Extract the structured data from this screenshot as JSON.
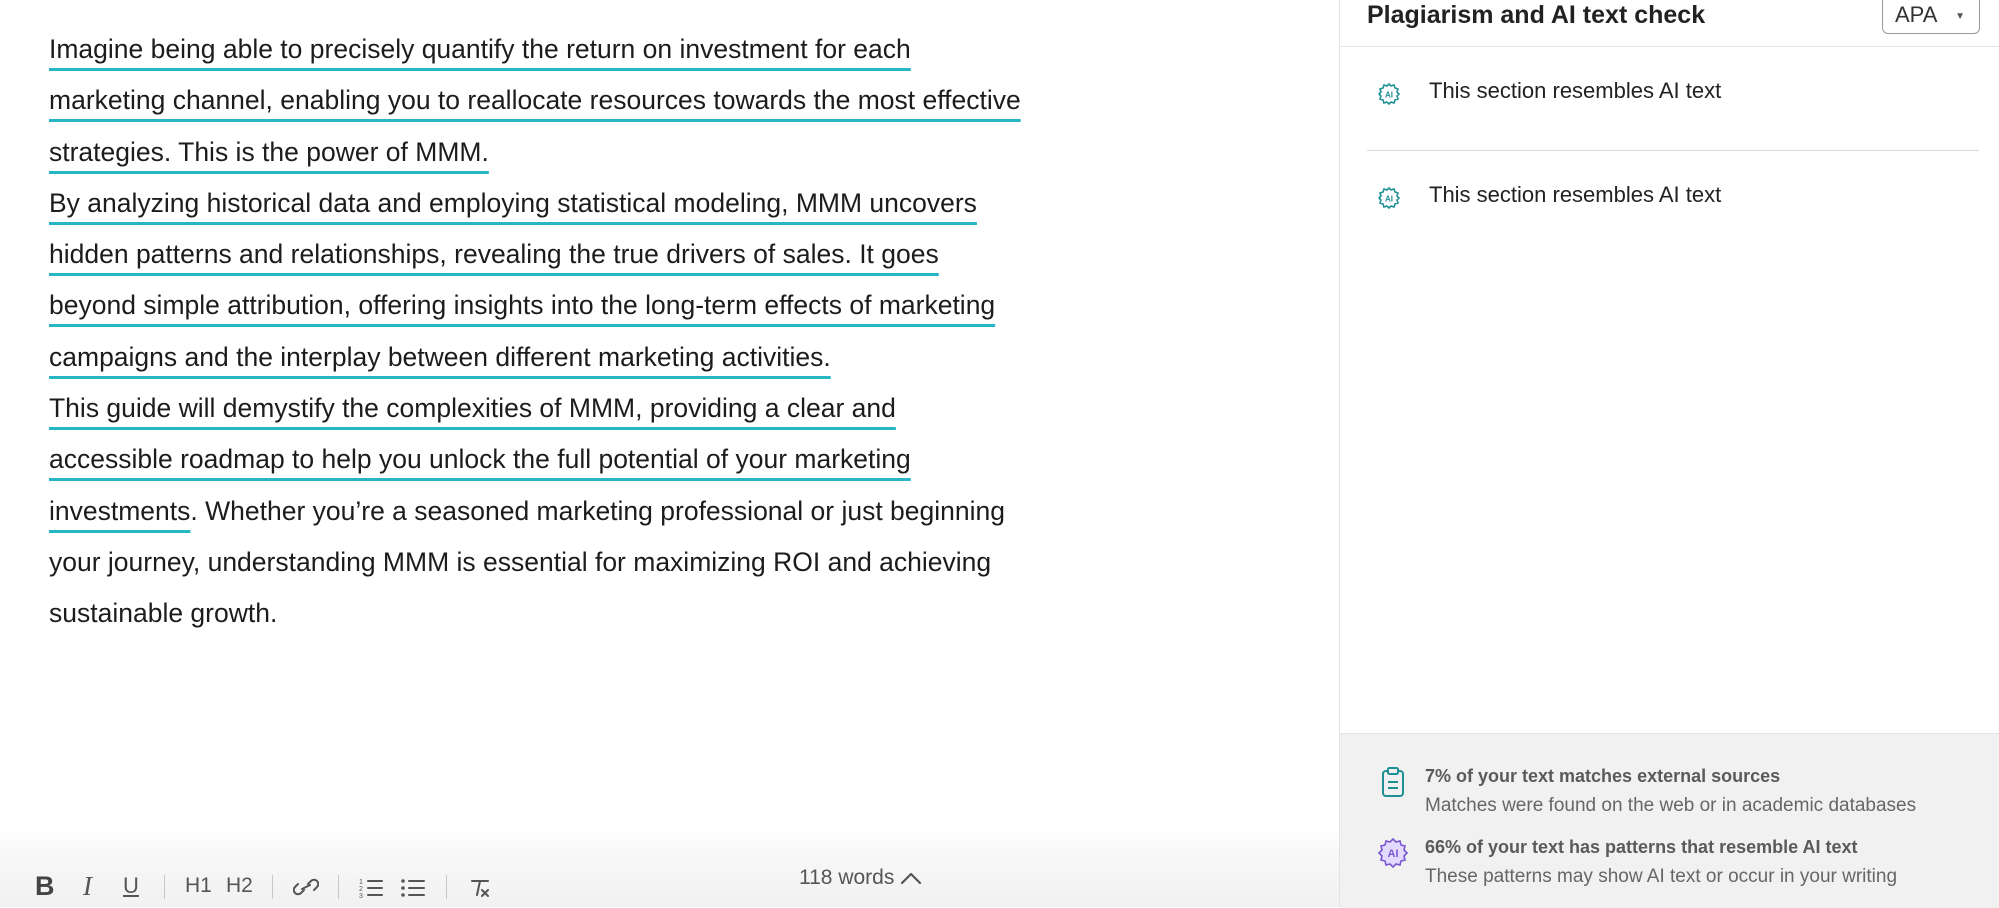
{
  "document": {
    "paragraphs": [
      {
        "highlighted": "Imagine being able to precisely quantify the return on investment for each marketing channel, enabling you to reallocate resources towards the most effective strategies. This is the power of MMM.",
        "plain": ""
      },
      {
        "highlighted": "By analyzing historical data and employing statistical modeling, MMM uncovers hidden patterns and relationships, revealing the true drivers of sales. It goes beyond simple attribution, offering insights into the long-term effects of marketing campaigns and the interplay between different marketing activities.",
        "plain": ""
      },
      {
        "highlighted": "This guide will demystify the complexities of MMM, providing a clear and accessible roadmap to help you unlock the full potential of your marketing investments",
        "plain": ". Whether you’re a seasoned marketing professional or just beginning your journey, understanding MMM is essential for maximizing ROI and achieving sustainable growth."
      }
    ]
  },
  "toolbar": {
    "bold": "B",
    "italic": "I",
    "underline": "U",
    "h1": "H1",
    "h2": "H2",
    "word_count": "118 words"
  },
  "panel": {
    "title": "Plagiarism and AI text check",
    "citation_style": "APA",
    "cards": [
      {
        "label": "This section resembles AI text",
        "icon": "ai-brain-icon"
      },
      {
        "label": "This section resembles AI text",
        "icon": "ai-brain-icon"
      }
    ],
    "summary": {
      "plagiarism_title": "7% of your text matches external sources",
      "plagiarism_sub": "Matches were found on the web or in academic databases",
      "ai_title": "66% of your text has patterns that resemble AI text",
      "ai_sub": "These patterns may show AI text or occur in your writing"
    }
  },
  "colors": {
    "highlight": "#27b6c4",
    "ai_icon_teal": "#1e8f93",
    "ai_icon_purple": "#7a57d1"
  }
}
